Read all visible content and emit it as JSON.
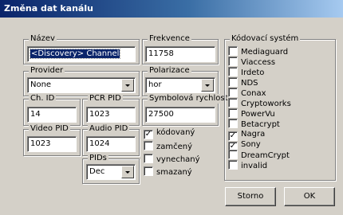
{
  "window": {
    "title": "Změna dat kanálu"
  },
  "fields": {
    "name": {
      "label": "Název",
      "value": "<Discovery> Channel"
    },
    "frequency": {
      "label": "Frekvence",
      "value": "11758"
    },
    "provider": {
      "label": "Provider",
      "value": "None"
    },
    "polarization": {
      "label": "Polarizace",
      "value": "hor"
    },
    "ch_id": {
      "label": "Ch. ID",
      "value": "14"
    },
    "pcr_pid": {
      "label": "PCR PID",
      "value": "1023"
    },
    "symbol_rate": {
      "label": "Symbolová rychlost",
      "value": "27500"
    },
    "video_pid": {
      "label": "Video PID",
      "value": "1023"
    },
    "audio_pid": {
      "label": "Audio PID",
      "value": "1024"
    },
    "pids": {
      "label": "PIDs",
      "value": "Dec"
    }
  },
  "flags": [
    {
      "label": "kódovaný",
      "checked": true
    },
    {
      "label": "zamčený",
      "checked": false
    },
    {
      "label": "vynechaný",
      "checked": false
    },
    {
      "label": "smazaný",
      "checked": false
    }
  ],
  "encoding": {
    "label": "Kódovací systém",
    "items": [
      {
        "label": "Mediaguard",
        "checked": false
      },
      {
        "label": "Viaccess",
        "checked": false
      },
      {
        "label": "Irdeto",
        "checked": false
      },
      {
        "label": "NDS",
        "checked": false
      },
      {
        "label": "Conax",
        "checked": false
      },
      {
        "label": "Cryptoworks",
        "checked": false
      },
      {
        "label": "PowerVu",
        "checked": false
      },
      {
        "label": "Betacrypt",
        "checked": false
      },
      {
        "label": "Nagra",
        "checked": true
      },
      {
        "label": "Sony",
        "checked": true
      },
      {
        "label": "DreamCrypt",
        "checked": false
      },
      {
        "label": "invalid",
        "checked": false
      }
    ]
  },
  "buttons": {
    "cancel": "Storno",
    "ok": "OK"
  },
  "check_mark": "✓",
  "colors": {
    "titlebar": "#0a246a",
    "face": "#d4d0c8"
  }
}
